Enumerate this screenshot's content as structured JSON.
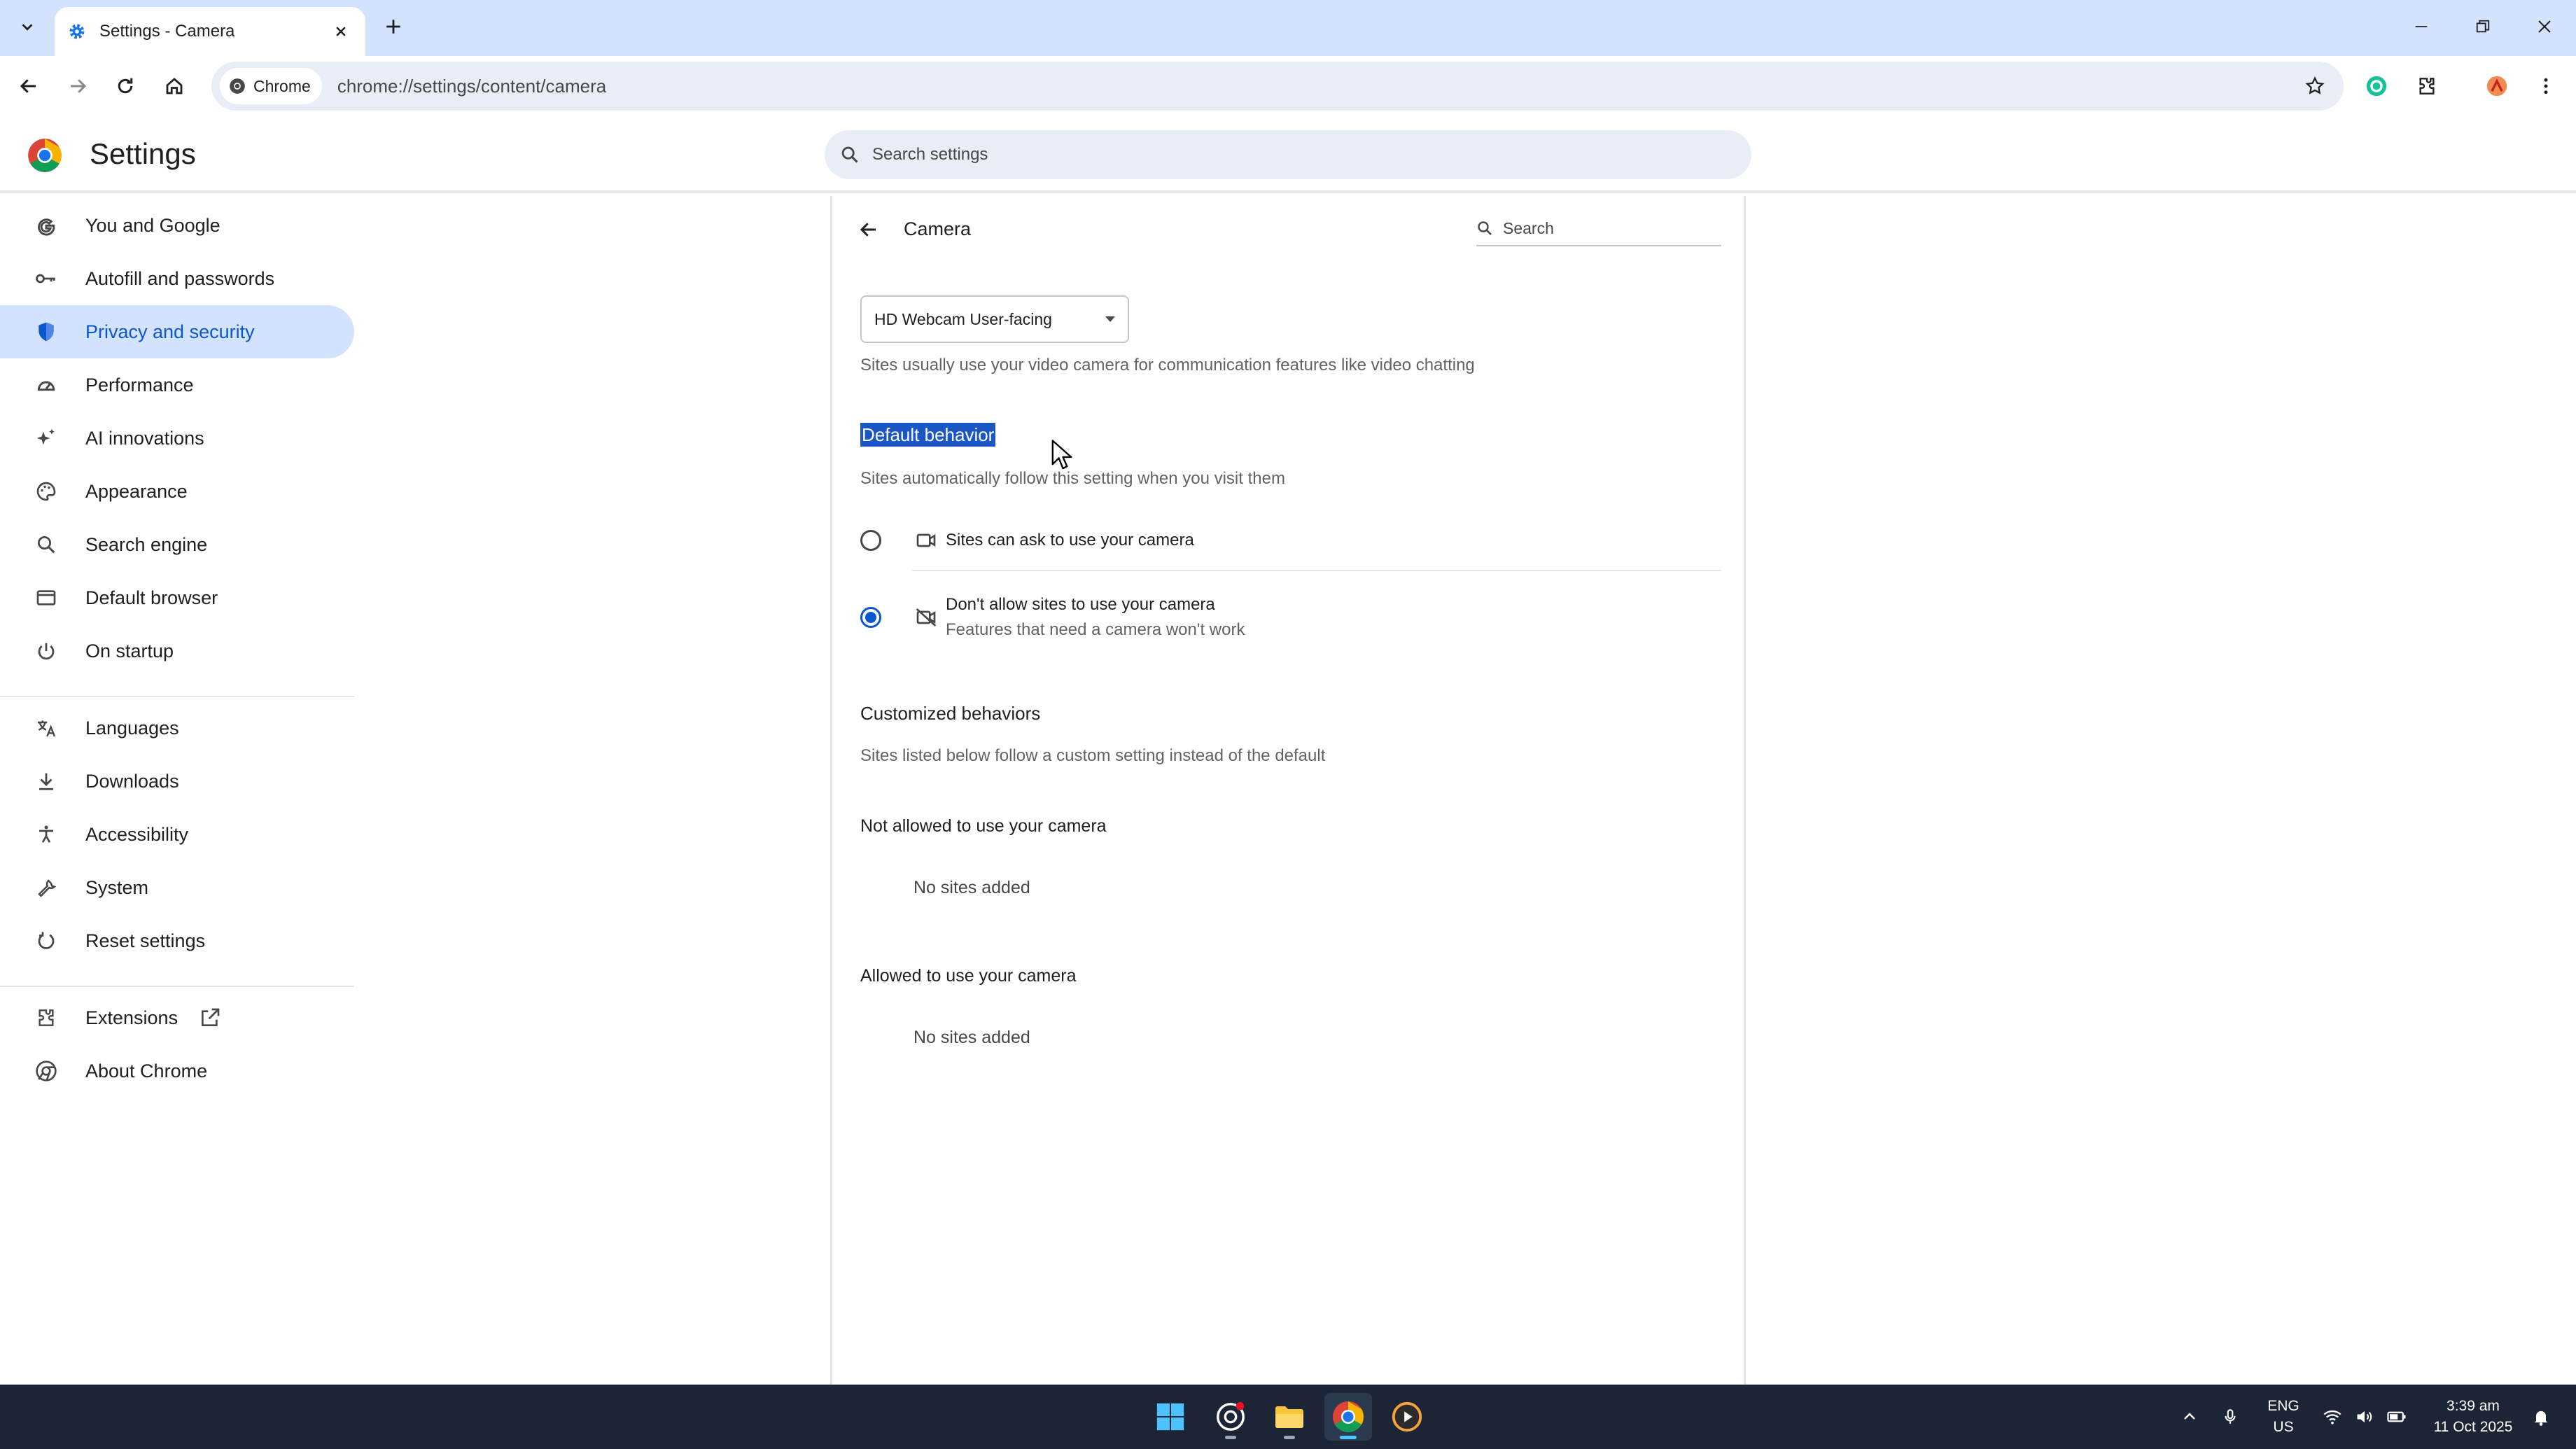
{
  "browser": {
    "tab_title": "Settings - Camera",
    "omnibox_chip": "Chrome",
    "url": "chrome://settings/content/camera"
  },
  "settings_header": {
    "title": "Settings",
    "search_placeholder": "Search settings"
  },
  "sidebar": {
    "items": [
      {
        "label": "You and Google",
        "icon": "google-g-icon"
      },
      {
        "label": "Autofill and passwords",
        "icon": "key-icon"
      },
      {
        "label": "Privacy and security",
        "icon": "shield-icon",
        "active": true
      },
      {
        "label": "Performance",
        "icon": "speedometer-icon"
      },
      {
        "label": "AI innovations",
        "icon": "sparkle-icon"
      },
      {
        "label": "Appearance",
        "icon": "palette-icon"
      },
      {
        "label": "Search engine",
        "icon": "search-icon"
      },
      {
        "label": "Default browser",
        "icon": "browser-window-icon"
      },
      {
        "label": "On startup",
        "icon": "power-icon"
      },
      {
        "label": "Languages",
        "icon": "translate-icon"
      },
      {
        "label": "Downloads",
        "icon": "download-icon"
      },
      {
        "label": "Accessibility",
        "icon": "accessibility-icon"
      },
      {
        "label": "System",
        "icon": "wrench-icon"
      },
      {
        "label": "Reset settings",
        "icon": "reset-icon"
      },
      {
        "label": "Extensions",
        "icon": "puzzle-icon"
      },
      {
        "label": "About Chrome",
        "icon": "chrome-icon"
      }
    ]
  },
  "camera_page": {
    "title": "Camera",
    "search_placeholder": "Search",
    "device_select": "HD Webcam User-facing",
    "device_description": "Sites usually use your video camera for communication features like video chatting",
    "default_behavior": {
      "heading": "Default behavior",
      "description": "Sites automatically follow this setting when you visit them",
      "options": [
        {
          "label": "Sites can ask to use your camera",
          "sublabel": "",
          "checked": false
        },
        {
          "label": "Don't allow sites to use your camera",
          "sublabel": "Features that need a camera won't work",
          "checked": true
        }
      ]
    },
    "customized": {
      "heading": "Customized behaviors",
      "description": "Sites listed below follow a custom setting instead of the default",
      "not_allowed_title": "Not allowed to use your camera",
      "not_allowed_empty": "No sites added",
      "allowed_title": "Allowed to use your camera",
      "allowed_empty": "No sites added"
    }
  },
  "taskbar": {
    "lang_line1": "ENG",
    "lang_line2": "US",
    "time": "3:39 am",
    "date": "11 Oct 2025"
  },
  "colors": {
    "accent": "#0b57d0",
    "active_nav_bg": "#d3e3fd",
    "tab_strip": "#d3e3fd",
    "taskbar": "#1b2536",
    "selection_highlight": "#1a56c4"
  }
}
